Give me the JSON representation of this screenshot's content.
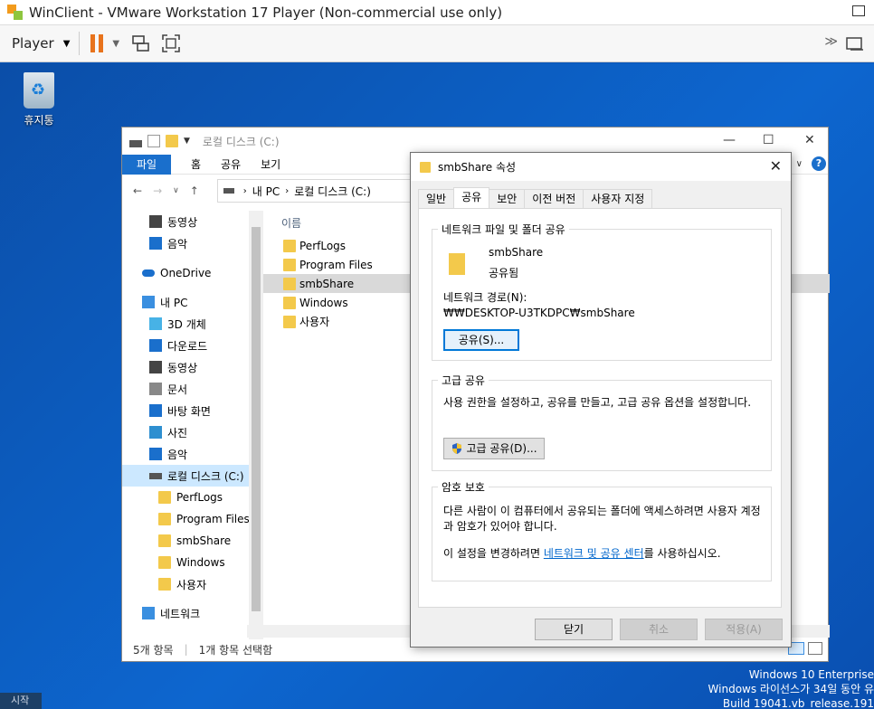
{
  "vmware": {
    "title": "WinClient - VMware Workstation 17 Player (Non-commercial use only)",
    "player_menu": "Player"
  },
  "desktop": {
    "recycle_bin": "휴지통",
    "version_lines": [
      "Windows 10 Enterprise",
      "Windows 라이선스가 34일 동안 유",
      "Build 19041.vb_release.191"
    ],
    "start_label": "시작"
  },
  "explorer": {
    "title": "로컬 디스크 (C:)",
    "ribbon_tabs": [
      "파일",
      "홈",
      "공유",
      "보기"
    ],
    "address": [
      "내 PC",
      "로컬 디스크 (C:)"
    ],
    "nav_items": [
      {
        "label": "동영상",
        "icon": "video"
      },
      {
        "label": "음악",
        "icon": "music"
      },
      {
        "label": "OneDrive",
        "icon": "cloud"
      },
      {
        "label": "내 PC",
        "icon": "pc"
      },
      {
        "label": "3D 개체",
        "icon": "3d"
      },
      {
        "label": "다운로드",
        "icon": "download"
      },
      {
        "label": "동영상",
        "icon": "video"
      },
      {
        "label": "문서",
        "icon": "doc"
      },
      {
        "label": "바탕 화면",
        "icon": "desktop"
      },
      {
        "label": "사진",
        "icon": "picture"
      },
      {
        "label": "음악",
        "icon": "music"
      },
      {
        "label": "로컬 디스크 (C:)",
        "icon": "drive"
      },
      {
        "label": "PerfLogs",
        "icon": "folder"
      },
      {
        "label": "Program Files",
        "icon": "folder"
      },
      {
        "label": "smbShare",
        "icon": "folder"
      },
      {
        "label": "Windows",
        "icon": "folder"
      },
      {
        "label": "사용자",
        "icon": "folder"
      },
      {
        "label": "네트워크",
        "icon": "network"
      }
    ],
    "column_name": "이름",
    "files": [
      "PerfLogs",
      "Program Files",
      "smbShare",
      "Windows",
      "사용자"
    ],
    "status_count": "5개 항목",
    "status_selected": "1개 항목 선택함"
  },
  "dialog": {
    "title": "smbShare 속성",
    "tabs": [
      "일반",
      "공유",
      "보안",
      "이전 버전",
      "사용자 지정"
    ],
    "network_group": "네트워크 파일 및 폴더 공유",
    "folder_name": "smbShare",
    "folder_state": "공유됨",
    "path_label": "네트워크 경로(N):",
    "path_value": "₩₩DESKTOP-U3TKDPC₩smbShare",
    "share_button": "공유(S)...",
    "adv_group": "고급 공유",
    "adv_text": "사용 권한을 설정하고, 공유를 만들고, 고급 공유 옵션을 설정합니다.",
    "adv_button": "고급 공유(D)...",
    "pw_group": "암호 보호",
    "pw_text": "다른 사람이 이 컴퓨터에서 공유되는 폴더에 액세스하려면 사용자 계정과 암호가 있어야 합니다.",
    "pw_change_prefix": "이 설정을 변경하려면 ",
    "pw_link": "네트워크 및 공유 센터",
    "pw_change_suffix": "를 사용하십시오.",
    "ok": "닫기",
    "cancel": "취소",
    "apply": "적용(A)"
  }
}
